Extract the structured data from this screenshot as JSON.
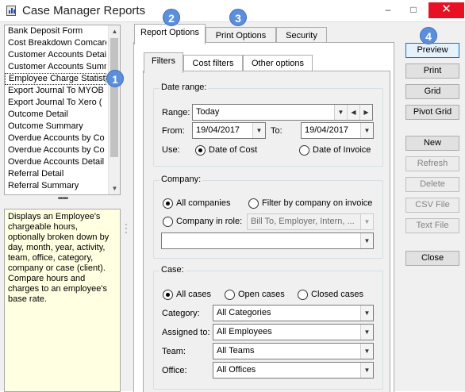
{
  "window": {
    "title": "Case Manager Reports",
    "controls": {
      "minimize": "–",
      "maximize": "□",
      "close": "✕"
    }
  },
  "reports": {
    "items": [
      "Bank Deposit Form",
      "Cost Breakdown Comcare",
      "Customer Accounts Detail",
      "Customer Accounts Summary",
      "Employee Charge Statistics",
      "Export Journal To MYOB",
      "Export Journal To Xero (",
      "Outcome Detail",
      "Outcome Summary",
      "Overdue Accounts by Co",
      "Overdue Accounts by Co",
      "Overdue Accounts Detail",
      "Referral Detail",
      "Referral Summary"
    ],
    "selected_index": 4,
    "description": "Displays an Employee's chargeable hours, optionally broken down by day, month, year, activity, team, office, category, company or case (client). Compare hours and charges to an employee's base rate."
  },
  "splitters": {
    "horizontal": "•••••",
    "vertical": "⋮"
  },
  "tabs": {
    "main": [
      "Report Options",
      "Print Options",
      "Security"
    ],
    "active_main": "Report Options",
    "sub": [
      "Filters",
      "Cost filters",
      "Other options"
    ],
    "active_sub": "Filters"
  },
  "date_range": {
    "group_title": "Date range:",
    "range_label": "Range:",
    "range_value": "Today",
    "from_label": "From:",
    "from_value": "19/04/2017",
    "to_label": "To:",
    "to_value": "19/04/2017",
    "use_label": "Use:",
    "use_options": [
      "Date of Cost",
      "Date of Invoice"
    ],
    "use_selected": "Date of Cost"
  },
  "company": {
    "group_title": "Company:",
    "opt_all": "All companies",
    "opt_filter": "Filter by company on invoice",
    "opt_role": "Company in role:",
    "role_value": "Bill To, Employer, Intern, ...",
    "company_value": "",
    "selected": "All companies"
  },
  "case": {
    "group_title": "Case:",
    "opt_all": "All cases",
    "opt_open": "Open cases",
    "opt_closed": "Closed cases",
    "selected": "All cases",
    "category_label": "Category:",
    "category_value": "All Categories",
    "assigned_label": "Assigned to:",
    "assigned_value": "All Employees",
    "team_label": "Team:",
    "team_value": "All Teams",
    "office_label": "Office:",
    "office_value": "All Offices"
  },
  "buttons": {
    "preview": "Preview",
    "print": "Print",
    "grid": "Grid",
    "pivot_grid": "Pivot Grid",
    "new": "New",
    "refresh": "Refresh",
    "delete": "Delete",
    "csv_file": "CSV File",
    "text_file": "Text File",
    "close": "Close"
  },
  "callouts": [
    "1",
    "2",
    "3",
    "4"
  ],
  "colors": {
    "callout": "#5b8fdb",
    "description_bg": "#ffffe1",
    "close_button": "#e81123"
  }
}
